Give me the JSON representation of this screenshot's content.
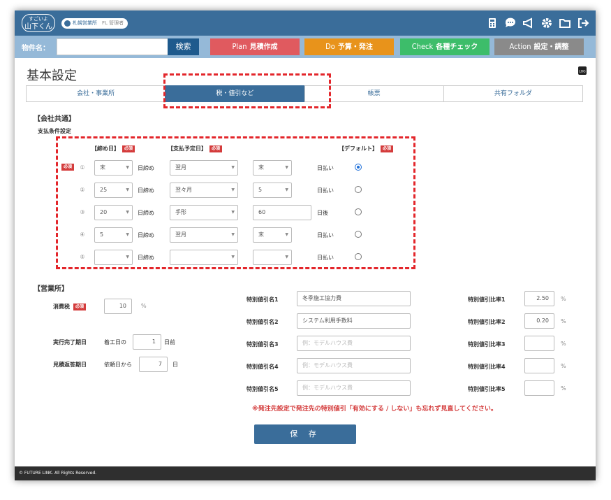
{
  "header": {
    "logo_top": "すごいよ",
    "logo_main": "山下くん",
    "office": "札幌営業所",
    "role": "FL 管理者"
  },
  "searchbar": {
    "label": "物件名：",
    "value": "",
    "button": "検索",
    "phases": [
      {
        "en": "Plan",
        "jp": "見積作成",
        "color": "#e05a5f"
      },
      {
        "en": "Do",
        "jp": "予算・発注",
        "color": "#e8931b"
      },
      {
        "en": "Check",
        "jp": "各種チェック",
        "color": "#3dbd6a"
      },
      {
        "en": "Action",
        "jp": "設定・調整",
        "color": "#8a8a8a"
      }
    ]
  },
  "page": {
    "title": "基本設定",
    "log_label": "LOG"
  },
  "tabs": [
    {
      "label": "会社・事業所",
      "active": false
    },
    {
      "label": "税・値引など",
      "active": true
    },
    {
      "label": "帳票",
      "active": false
    },
    {
      "label": "共有フォルダ",
      "active": false
    }
  ],
  "company": {
    "heading": "【会社共通】",
    "sub": "支払条件設定",
    "required": "必須",
    "col_close": "【締め日】",
    "col_pay": "【支払予定日】",
    "col_default": "【デフォルト】",
    "rows": [
      {
        "no": "①",
        "close": "末",
        "suffix": "日締め",
        "pay_month": "翌月",
        "pay_day": "末",
        "pay_day_type": "select",
        "end": "日払い",
        "default": true
      },
      {
        "no": "②",
        "close": "25",
        "suffix": "日締め",
        "pay_month": "翌々月",
        "pay_day": "5",
        "pay_day_type": "select",
        "end": "日払い",
        "default": false
      },
      {
        "no": "③",
        "close": "20",
        "suffix": "日締め",
        "pay_month": "手形",
        "pay_day": "60",
        "pay_day_type": "input",
        "end": "日後",
        "default": false
      },
      {
        "no": "④",
        "close": "5",
        "suffix": "日締め",
        "pay_month": "翌月",
        "pay_day": "末",
        "pay_day_type": "select",
        "end": "日払い",
        "default": false
      },
      {
        "no": "⑤",
        "close": "",
        "suffix": "日締め",
        "pay_month": "",
        "pay_day": "",
        "pay_day_type": "select",
        "end": "日払い",
        "default": false
      }
    ]
  },
  "office": {
    "heading": "【営業所】",
    "tax_label": "消費税",
    "tax_value": "10",
    "tax_unit": "%",
    "completion_label": "実行完了期日",
    "completion_prefix": "着工日の",
    "completion_value": "1",
    "completion_suffix": "日前",
    "reply_label": "見積返答期日",
    "reply_prefix": "依頼日から",
    "reply_value": "7",
    "reply_suffix": "日",
    "discounts": [
      {
        "name_label": "特別値引名1",
        "name": "冬季施工協力費",
        "placeholder": "",
        "rate_label": "特別値引比率1",
        "rate": "2.50"
      },
      {
        "name_label": "特別値引名2",
        "name": "システム利用手数料",
        "placeholder": "",
        "rate_label": "特別値引比率2",
        "rate": "0.20"
      },
      {
        "name_label": "特別値引名3",
        "name": "",
        "placeholder": "例：モデルハウス費",
        "rate_label": "特別値引比率3",
        "rate": ""
      },
      {
        "name_label": "特別値引名4",
        "name": "",
        "placeholder": "例：モデルハウス費",
        "rate_label": "特別値引比率4",
        "rate": ""
      },
      {
        "name_label": "特別値引名5",
        "name": "",
        "placeholder": "例：モデルハウス費",
        "rate_label": "特別値引比率5",
        "rate": ""
      }
    ],
    "rate_unit": "%",
    "notice": "※発注先設定で発注先の特別値引「有効にする / しない」も忘れず見直してください。"
  },
  "save_label": "保 存",
  "footer": "© FUTURE LINK. All Rights Reserved."
}
